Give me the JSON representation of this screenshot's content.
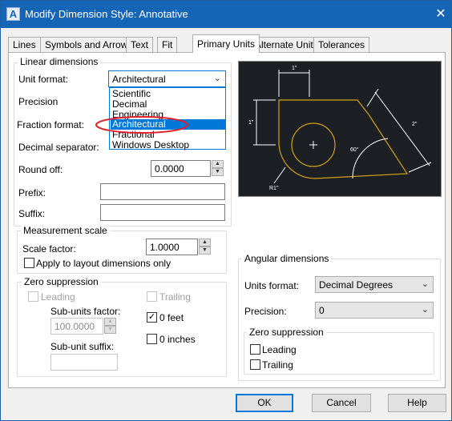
{
  "window": {
    "title": "Modify Dimension Style: Annotative",
    "close_glyph": "✕",
    "app_icon_letter": "A"
  },
  "tabs": [
    {
      "label": "Lines",
      "active": false
    },
    {
      "label": "Symbols and Arrows",
      "active": false
    },
    {
      "label": "Text",
      "active": false
    },
    {
      "label": "Fit",
      "active": false
    },
    {
      "label": "Primary Units",
      "active": true
    },
    {
      "label": "Alternate Units",
      "active": false
    },
    {
      "label": "Tolerances",
      "active": false
    }
  ],
  "linear": {
    "group_title": "Linear dimensions",
    "unit_format_label": "Unit format:",
    "unit_format_value": "Architectural",
    "precision_label": "Precision",
    "fraction_format_label": "Fraction format:",
    "decimal_separator_label": "Decimal separator:",
    "round_off_label": "Round off:",
    "round_off_value": "0.0000",
    "prefix_label": "Prefix:",
    "prefix_value": "",
    "suffix_label": "Suffix:",
    "suffix_value": ""
  },
  "unit_format_options": [
    "Scientific",
    "Decimal",
    "Engineering",
    "Architectural",
    "Fractional",
    "Windows Desktop"
  ],
  "unit_format_selected_index": 3,
  "measurement": {
    "group_title": "Measurement scale",
    "scale_factor_label": "Scale factor:",
    "scale_factor_value": "1.0000",
    "apply_layout_label": "Apply to layout dimensions only",
    "apply_layout_checked": false
  },
  "zero_linear": {
    "group_title": "Zero suppression",
    "leading_label": "Leading",
    "leading_checked": false,
    "trailing_label": "Trailing",
    "trailing_checked": false,
    "subunits_factor_label": "Sub-units factor:",
    "subunits_factor_value": "100.0000",
    "subunit_suffix_label": "Sub-unit suffix:",
    "subunit_suffix_value": "",
    "zero_feet_label": "0 feet",
    "zero_feet_checked": true,
    "zero_inches_label": "0 inches",
    "zero_inches_checked": false
  },
  "angular": {
    "group_title": "Angular dimensions",
    "units_format_label": "Units format:",
    "units_format_value": "Decimal Degrees",
    "precision_label": "Precision:",
    "precision_value": "0",
    "zero_group_title": "Zero suppression",
    "leading_label": "Leading",
    "leading_checked": false,
    "trailing_label": "Trailing",
    "trailing_checked": false
  },
  "preview": {
    "dim_top": "1\"",
    "dim_left": "1\"",
    "dim_diag": "2\"",
    "dim_angle": "60°",
    "dim_radius": "R1\"",
    "geometry_color": "#d4a017",
    "dim_color": "#ffffff",
    "background": "#1c1f24"
  },
  "buttons": {
    "ok": "OK",
    "cancel": "Cancel",
    "help": "Help"
  },
  "colors": {
    "titlebar": "#1565b7",
    "accent": "#0078d7",
    "annotation": "#e0202a"
  }
}
